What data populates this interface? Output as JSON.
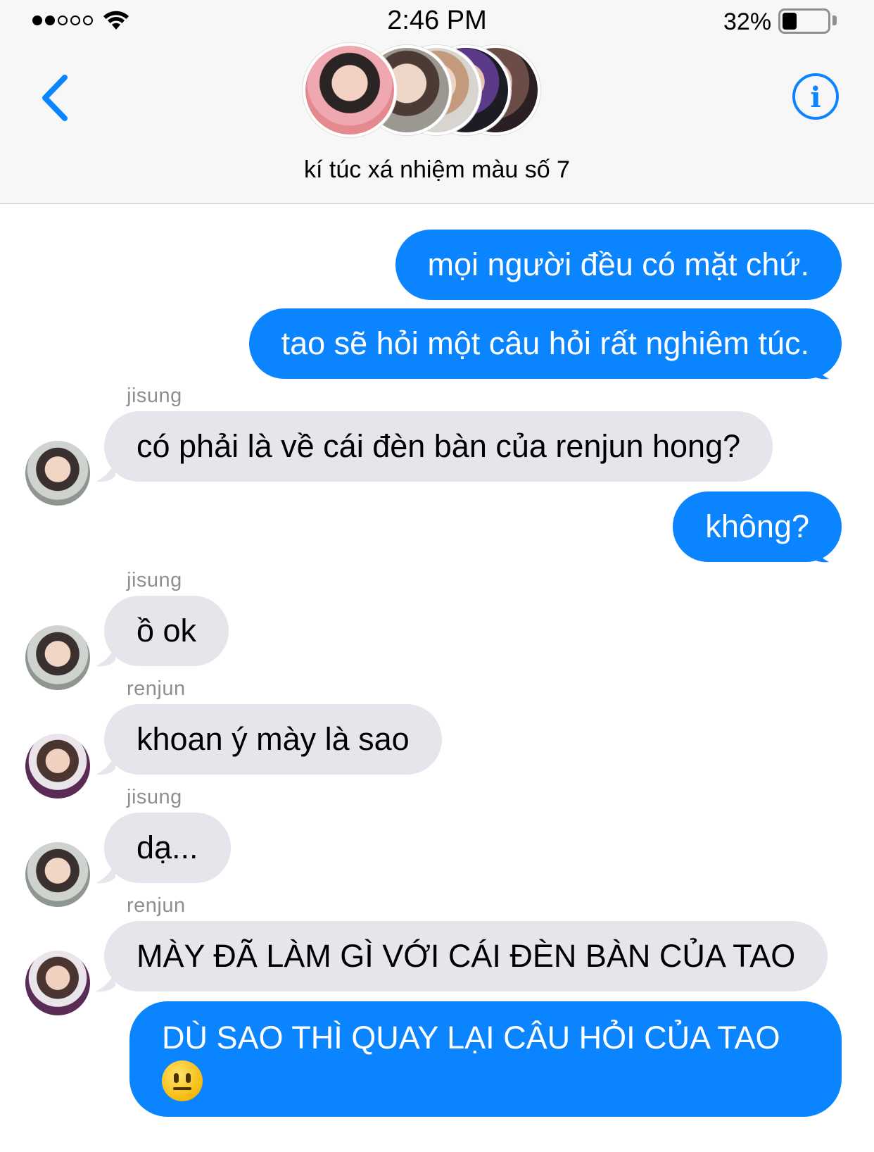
{
  "status_bar": {
    "time": "2:46 PM",
    "battery_percent": "32%",
    "battery_level": 0.32,
    "signal_bars_filled": 2,
    "signal_bars_total": 5,
    "wifi_icon": "wifi-icon"
  },
  "header": {
    "back_icon": "chevron-left-icon",
    "info_icon": "info-icon",
    "group_name": "kí túc xá nhiệm màu số 7"
  },
  "colors": {
    "outgoing_bubble": "#0a84ff",
    "incoming_bubble": "#e6e5eb",
    "accent": "#0a84ff",
    "sender_label": "#8e8e93"
  },
  "messages": [
    {
      "direction": "out",
      "text": "mọi người đều có mặt chứ."
    },
    {
      "direction": "out",
      "text": "tao sẽ hỏi một câu hỏi rất nghiêm túc."
    },
    {
      "direction": "in",
      "sender": "jisung",
      "text": "có phải là về cái đèn bàn của renjun hong?"
    },
    {
      "direction": "out",
      "text": "không?"
    },
    {
      "direction": "in",
      "sender": "jisung",
      "text": "ồ ok"
    },
    {
      "direction": "in",
      "sender": "renjun",
      "text": "khoan ý mày là sao"
    },
    {
      "direction": "in",
      "sender": "jisung",
      "text": "dạ..."
    },
    {
      "direction": "in",
      "sender": "renjun",
      "text": "MÀY ĐÃ LÀM GÌ VỚI CÁI ĐÈN BÀN CỦA TAO"
    },
    {
      "direction": "out",
      "text": "DÙ SAO THÌ QUAY LẠI CÂU HỎI CỦA TAO",
      "emoji": "neutral-face-emoji"
    }
  ]
}
